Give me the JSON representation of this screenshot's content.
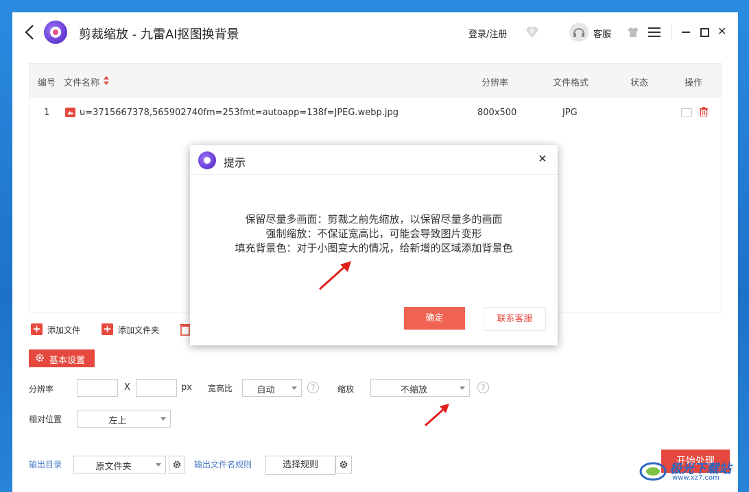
{
  "app": {
    "title": "剪裁缩放 - 九雷AI抠图换背景",
    "login_label": "登录/注册",
    "customer_service_label": "客服",
    "close_glyph": "✕"
  },
  "file_table": {
    "headers": {
      "index": "编号",
      "filename": "文件名称",
      "resolution": "分辨率",
      "format": "文件格式",
      "status": "状态",
      "action": "操作"
    },
    "rows": [
      {
        "index": "1",
        "filename": "u=3715667378,565902740fm=253fmt=autoapp=138f=JPEG.webp.jpg",
        "resolution": "800x500",
        "format": "JPG",
        "status": ""
      }
    ]
  },
  "toolbar": {
    "add_file": "添加文件",
    "add_folder": "添加文件夹",
    "plus": "+"
  },
  "settings": {
    "basic_label": "基本设置",
    "resolution_label": "分辨率",
    "x_label": "X",
    "px_label": "px",
    "width_value": "",
    "height_value": "",
    "aspect_label": "宽高比",
    "aspect_value": "自动",
    "scale_label": "缩放",
    "scale_value": "不缩放",
    "position_label": "相对位置",
    "position_value": "左上",
    "help_glyph": "?"
  },
  "output": {
    "dir_label": "输出目录",
    "dir_value": "原文件夹",
    "rule_label": "输出文件名规则",
    "rule_button": "选择规则",
    "start_button": "开始处理"
  },
  "dialog": {
    "title": "提示",
    "close_glyph": "✕",
    "lines": [
      "保留尽量多画面：剪裁之前先缩放，以保留尽量多的画面",
      "强制缩放：不保证宽高比，可能会导致图片变形",
      "填充背景色：对于小图变大的情况，给新增的区域添加背景色"
    ],
    "ok_button": "确定",
    "contact_button": "联系客服"
  },
  "watermark": {
    "text": "极光下载站",
    "sub": "www.xz7.com"
  },
  "colors": {
    "accent": "#e5483e",
    "desktop": "#1976c9"
  }
}
